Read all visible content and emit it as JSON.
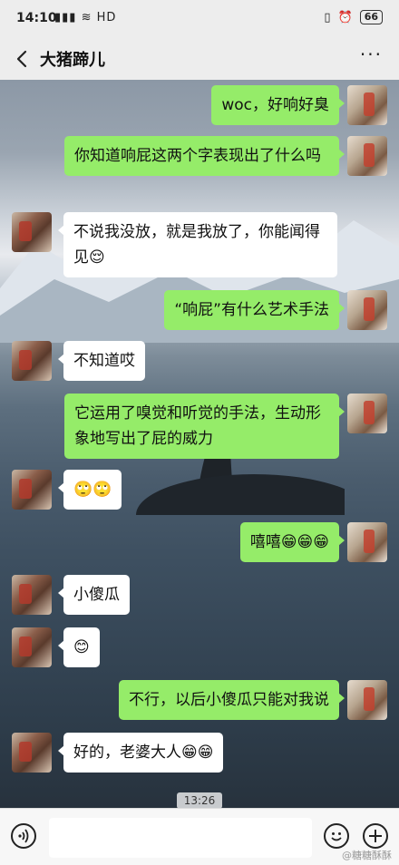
{
  "status_bar": {
    "time": "14:10",
    "signal_icons": "▮▮▮ ≋",
    "network": "HD",
    "battery": "66"
  },
  "nav": {
    "title": "大猪蹄儿",
    "more": "···"
  },
  "messages": [
    {
      "side": "right",
      "text": "woc，好响好臭"
    },
    {
      "side": "right",
      "text": "你知道响屁这两个字表现出了什么吗"
    },
    {
      "side": "left",
      "text": "不说我没放，就是我放了，你能闻得见😌"
    },
    {
      "side": "right",
      "text": "“响屁”有什么艺术手法"
    },
    {
      "side": "left",
      "text": "不知道哎"
    },
    {
      "side": "right",
      "text": "它运用了嗅觉和听觉的手法，生动形象地写出了屁的威力"
    },
    {
      "side": "left",
      "text": "🙄🙄"
    },
    {
      "side": "right",
      "text": "嘻嘻😁😁😁"
    },
    {
      "side": "left",
      "text": "小傻瓜"
    },
    {
      "side": "left",
      "text": "😊"
    },
    {
      "side": "right",
      "text": "不行，以后小傻瓜只能对我说"
    },
    {
      "side": "left",
      "text": "好的，老婆大人😁😁"
    }
  ],
  "timestamp": "13:26",
  "input": {
    "value": "",
    "placeholder": ""
  },
  "watermark": "@糖糖酥酥",
  "colors": {
    "sent_bubble": "#95ec69",
    "received_bubble": "#ffffff",
    "bar_bg": "#ededed"
  },
  "icons": {
    "back": "chevron-left-icon",
    "voice": "voice-icon",
    "emoji": "emoji-icon",
    "plus": "plus-icon",
    "more": "more-icon"
  }
}
